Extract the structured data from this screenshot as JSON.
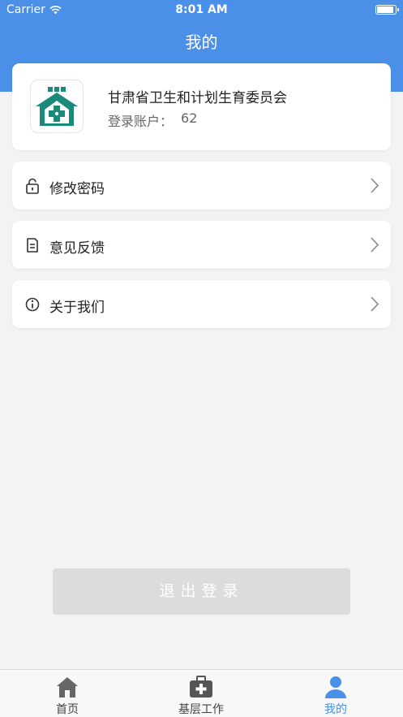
{
  "status_bar": {
    "carrier": "Carrier",
    "time": "8:01 AM"
  },
  "header": {
    "title": "我的"
  },
  "profile": {
    "org_name": "甘肃省卫生和计划生育委员会",
    "account_label": "登录账户：",
    "account_value": "62",
    "logo_icon": "health-org-logo-icon"
  },
  "menu": [
    {
      "label": "修改密码",
      "icon": "lock-icon"
    },
    {
      "label": "意见反馈",
      "icon": "feedback-icon"
    },
    {
      "label": "关于我们",
      "icon": "info-icon"
    }
  ],
  "logout_label": "退出登录",
  "tabbar": [
    {
      "label": "首页",
      "icon": "home-icon",
      "active": false
    },
    {
      "label": "基层工作",
      "icon": "medical-kit-icon",
      "active": false
    },
    {
      "label": "我的",
      "icon": "user-icon",
      "active": true
    }
  ],
  "colors": {
    "primary": "#4a90e8",
    "logo_green": "#1a8a7a",
    "background": "#f3f3f3",
    "logout_bg": "#dcdcdc"
  }
}
